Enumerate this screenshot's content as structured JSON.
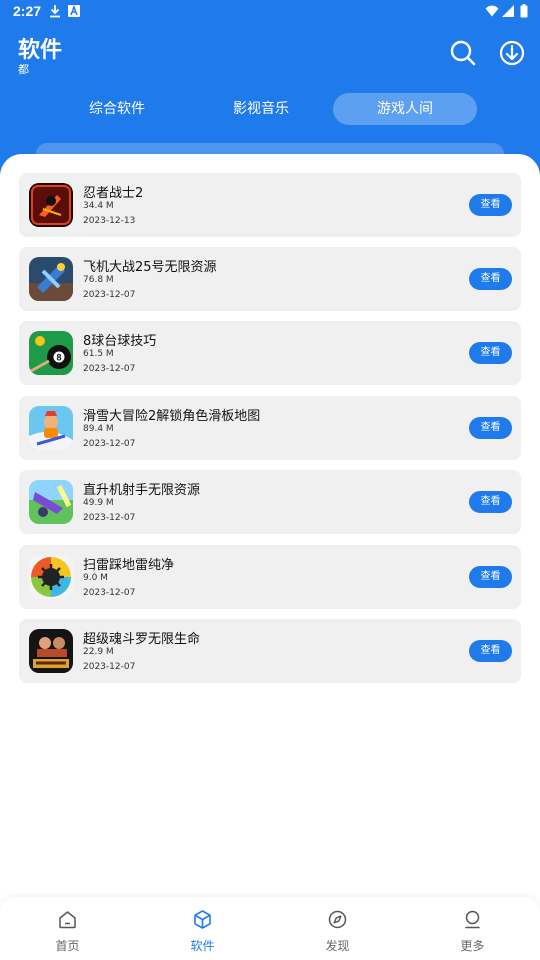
{
  "status": {
    "time": "2:27"
  },
  "header": {
    "title": "软件",
    "subtitle": "都"
  },
  "tabs": [
    {
      "label": "综合软件"
    },
    {
      "label": "影视音乐"
    },
    {
      "label": "游戏人间",
      "active": true
    }
  ],
  "apps": [
    {
      "name": " 忍者战士2",
      "size": "34.4 M",
      "date": "2023-12-13",
      "button": "查看",
      "icon": "ninja-game-icon"
    },
    {
      "name": "飞机大战25号无限资源",
      "size": "76.8 M",
      "date": "2023-12-07",
      "button": "查看",
      "icon": "plane-game-icon"
    },
    {
      "name": "8球台球技巧",
      "size": "61.5 M",
      "date": "2023-12-07",
      "button": "查看",
      "icon": "billiards-game-icon"
    },
    {
      "name": "滑雪大冒险2解锁角色滑板地图",
      "size": "89.4 M",
      "date": "2023-12-07",
      "button": "查看",
      "icon": "ski-game-icon"
    },
    {
      "name": "直升机射手无限资源",
      "size": "49.9 M",
      "date": "2023-12-07",
      "button": "查看",
      "icon": "helicopter-game-icon"
    },
    {
      "name": "扫雷踩地雷纯净",
      "size": "9.0 M",
      "date": "2023-12-07",
      "button": "查看",
      "icon": "minesweeper-game-icon"
    },
    {
      "name": "超级魂斗罗无限生命",
      "size": "22.9 M",
      "date": "2023-12-07",
      "button": "查看",
      "icon": "contra-game-icon"
    }
  ],
  "nav": [
    {
      "label": "首页",
      "icon": "home-icon"
    },
    {
      "label": "软件",
      "icon": "cube-icon",
      "active": true
    },
    {
      "label": "发现",
      "icon": "compass-icon"
    },
    {
      "label": "更多",
      "icon": "profile-icon"
    }
  ],
  "colors": {
    "primary": "#1f7bec",
    "card": "#f0f0f0"
  }
}
